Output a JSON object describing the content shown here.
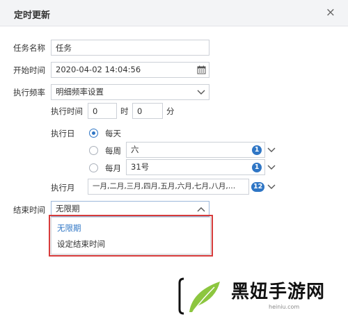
{
  "dialog": {
    "title": "定时更新",
    "close_glyph": "×"
  },
  "form": {
    "task_name": {
      "label": "任务名称",
      "value": "任务"
    },
    "start_time": {
      "label": "开始时间",
      "value": "2020-04-02 14:04:56"
    },
    "frequency": {
      "label": "执行频率",
      "value": "明细频率设置"
    },
    "exec_time": {
      "label": "执行时间",
      "hour": "0",
      "hour_unit": "时",
      "minute": "0",
      "minute_unit": "分"
    },
    "exec_day": {
      "label": "执行日",
      "daily_label": "每天",
      "weekly_label": "每周",
      "weekly_value": "六",
      "weekly_count": "1",
      "monthly_label": "每月",
      "monthly_value": "31号",
      "monthly_count": "1",
      "selected": "daily"
    },
    "exec_month": {
      "label": "执行月",
      "value": "一月,二月,三月,四月,五月,六月,七月,八月,…",
      "count": "12"
    },
    "end_time": {
      "label": "结束时间",
      "value": "无限期",
      "options": [
        "无限期",
        "设定结束时间"
      ]
    }
  },
  "watermark": {
    "text": "黑妞手游网",
    "sub": "heiniu.com"
  },
  "colors": {
    "accent": "#2f76c5",
    "highlight": "#d73b3b",
    "header_bg": "#f3f4f6"
  }
}
